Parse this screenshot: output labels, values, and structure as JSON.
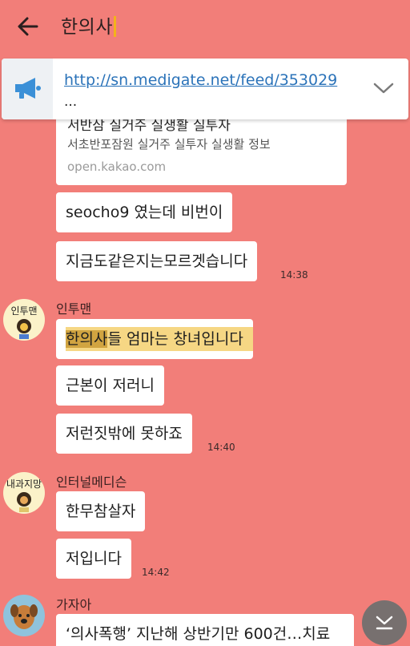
{
  "header": {
    "back_icon": "arrow-left-icon",
    "search_query": "한의사"
  },
  "notice": {
    "icon": "megaphone-icon",
    "link": "http://sn.medigate.net/feed/353029",
    "more": "...",
    "expand_icon": "chevron-down-icon"
  },
  "link_card": {
    "title": "서반삼 실거주 실생활 실투자",
    "description": "서초반포잠원 실거주 실투자 실생활 정보",
    "domain": "open.kakao.com"
  },
  "messages": [
    {
      "text": "seocho9 였는데 비번이"
    },
    {
      "text": "지금도같은지는모르겟습니다",
      "time": "14:38"
    },
    {
      "sender": "인투맨",
      "avatar_label": "인투맨",
      "text_highlight": "한의사",
      "text_rest": "들 엄마는 창녀입니다"
    },
    {
      "text": "근본이 저러니"
    },
    {
      "text": "저런짓밖에 못하죠",
      "time": "14:40"
    },
    {
      "sender": "인터널메디슨",
      "avatar_label": "내과지망",
      "text": "한무참살자"
    },
    {
      "text": "저입니다",
      "time": "14:42"
    },
    {
      "sender": "가자아",
      "text": "‘의사폭행’ 지난해 상반기만 600건…치료"
    }
  ],
  "scroll_button": {
    "icon": "scroll-to-bottom-icon"
  },
  "colors": {
    "background": "#f27e79",
    "bubble": "#ffffff",
    "link": "#2b73b9",
    "highlight": "#d1a441",
    "highlight_soft": "#f6d784",
    "caret": "#f3b31a"
  }
}
